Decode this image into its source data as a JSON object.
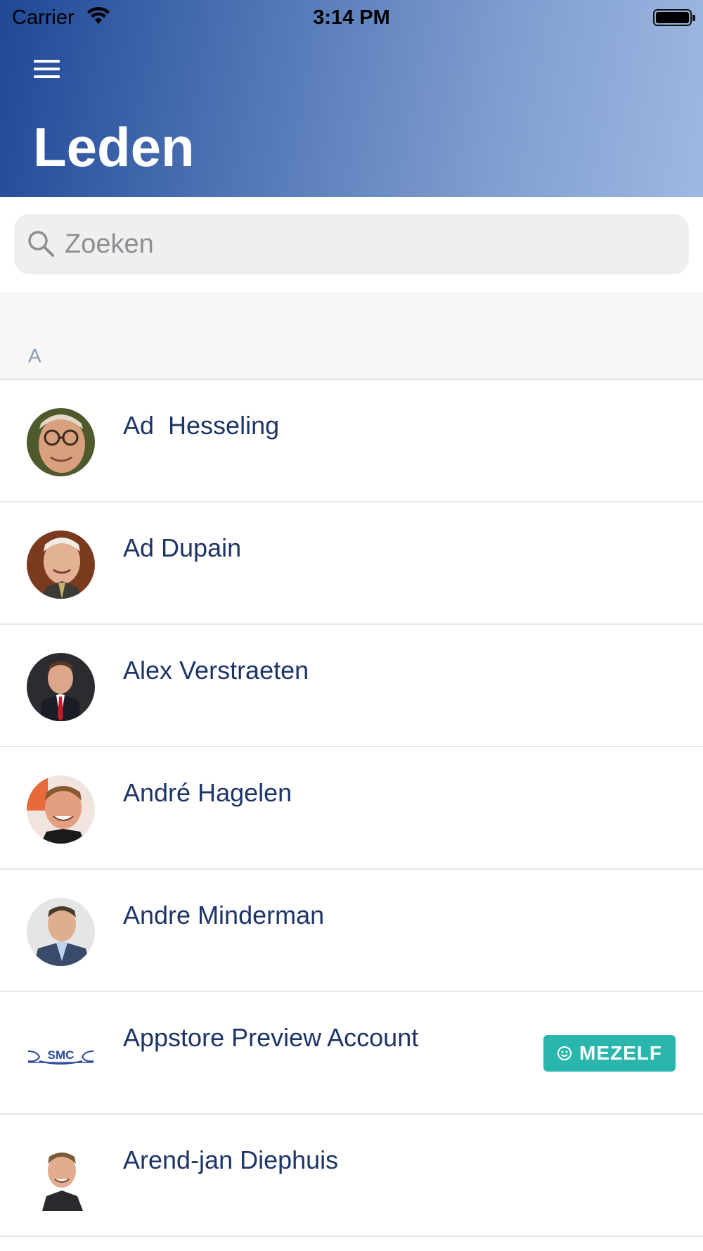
{
  "status_bar": {
    "carrier": "Carrier",
    "time": "3:14 PM"
  },
  "header": {
    "title": "Leden",
    "menu_icon": "hamburger-menu-icon"
  },
  "search": {
    "placeholder": "Zoeken",
    "value": "",
    "icon": "search-icon"
  },
  "section": {
    "letter": "A"
  },
  "members": [
    {
      "name": "Ad  Hesseling",
      "avatar": "photo"
    },
    {
      "name": "Ad Dupain",
      "avatar": "photo"
    },
    {
      "name": "Alex Verstraeten",
      "avatar": "photo"
    },
    {
      "name": "André Hagelen",
      "avatar": "photo"
    },
    {
      "name": "Andre Minderman",
      "avatar": "photo"
    },
    {
      "name": "Appstore Preview Account",
      "avatar": "smc-logo",
      "logo_text": "SMC",
      "badge": "MEZELF"
    },
    {
      "name": "Arend-jan Diephuis",
      "avatar": "photo"
    }
  ],
  "colors": {
    "header_start": "#1f4896",
    "header_end": "#9fb8e2",
    "name_text": "#1d3566",
    "badge_bg": "#2bb6ad"
  }
}
